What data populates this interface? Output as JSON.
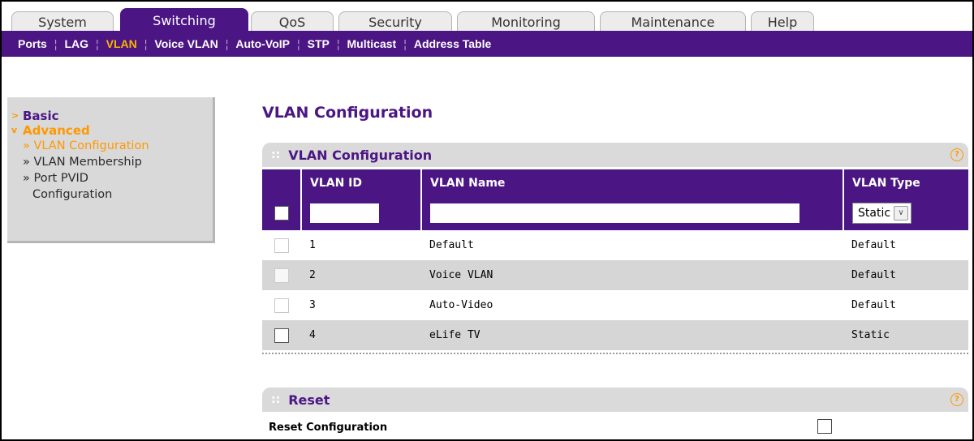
{
  "tabs": [
    {
      "label": "System"
    },
    {
      "label": "Switching",
      "active": true
    },
    {
      "label": "QoS"
    },
    {
      "label": "Security"
    },
    {
      "label": "Monitoring"
    },
    {
      "label": "Maintenance"
    },
    {
      "label": "Help"
    }
  ],
  "subnav": [
    {
      "label": "Ports"
    },
    {
      "label": "LAG"
    },
    {
      "label": "VLAN",
      "active": true
    },
    {
      "label": "Voice VLAN"
    },
    {
      "label": "Auto-VoIP"
    },
    {
      "label": "STP"
    },
    {
      "label": "Multicast"
    },
    {
      "label": "Address Table"
    }
  ],
  "leftnav": {
    "basic": "Basic",
    "advanced": "Advanced",
    "items": [
      "» VLAN Configuration",
      "» VLAN Membership",
      "» Port PVID",
      "Configuration"
    ]
  },
  "page_title": "VLAN Configuration",
  "config_section": {
    "title": "VLAN Configuration",
    "columns": {
      "id": "VLAN ID",
      "name": "VLAN Name",
      "type": "VLAN Type"
    },
    "new_row": {
      "id_value": "",
      "name_value": "",
      "type_value": "Static"
    },
    "rows": [
      {
        "id": "1",
        "name": "Default",
        "type": "Default"
      },
      {
        "id": "2",
        "name": "Voice VLAN",
        "type": "Default"
      },
      {
        "id": "3",
        "name": "Auto-Video",
        "type": "Default"
      },
      {
        "id": "4",
        "name": "eLife TV",
        "type": "Static"
      }
    ]
  },
  "reset_section": {
    "title": "Reset",
    "label": "Reset Configuration"
  },
  "help_glyph": "?",
  "colors": {
    "brand": "#4b1684",
    "accent": "#ff9800",
    "row_alt": "#d6d6d6"
  }
}
